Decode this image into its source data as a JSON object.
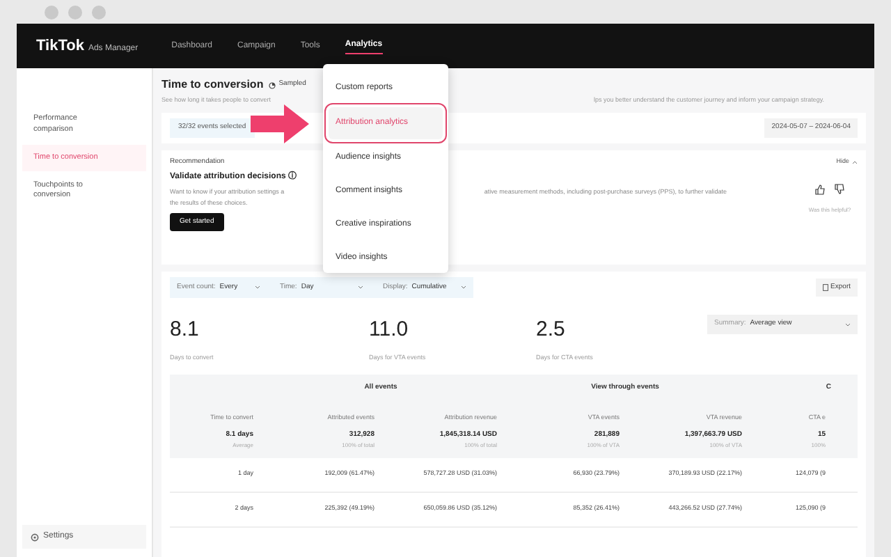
{
  "nav": {
    "logo": "TikTok",
    "logo_suffix": "Ads Manager",
    "items": [
      {
        "label": "Dashboard",
        "selected": false
      },
      {
        "label": "Campaign",
        "selected": false
      },
      {
        "label": "Tools",
        "selected": false
      },
      {
        "label": "Analytics",
        "selected": true
      }
    ]
  },
  "menu": {
    "items": [
      {
        "label": "Custom reports",
        "selected": false
      },
      {
        "label": "Attribution analytics",
        "selected": true
      },
      {
        "label": "Audience insights",
        "selected": false
      },
      {
        "label": "Comment insights",
        "selected": false
      },
      {
        "label": "Creative inspirations",
        "selected": false
      },
      {
        "label": "Video insights",
        "selected": false
      }
    ]
  },
  "sidebar": {
    "items": [
      {
        "label": "Performance comparison",
        "selected": false
      },
      {
        "label": "Time to conversion",
        "selected": true
      },
      {
        "label": "Touchpoints to conversion",
        "selected": false
      }
    ],
    "settings": "Settings"
  },
  "page": {
    "title": "Time to conversion",
    "badge": "Sampled",
    "description": "See how long it takes people to convert",
    "description_end": "lps you better understand the customer journey and inform your campaign strategy.",
    "events": "32/32 events selected",
    "date_range": "2024-05-07 – 2024-06-04"
  },
  "recommendation": {
    "label": "Recommendation",
    "title": "Validate attribution decisions ⓘ",
    "text": "Want to know if your attribution settings a",
    "text_end": "ative measurement methods, including post-purchase surveys (PPS), to further validate",
    "text_line2": "the results of these choices.",
    "button": "Get started",
    "hide": "Hide",
    "feedback": "Was this helpful?"
  },
  "filters": [
    {
      "label": "Event count:",
      "value": "Every"
    },
    {
      "label": "Time:",
      "value": "Day"
    },
    {
      "label": "Display:",
      "value": "Cumulative"
    }
  ],
  "export": "Export",
  "stats": [
    {
      "value": "8.1",
      "label": "Days to convert"
    },
    {
      "value": "11.0",
      "label": "Days for VTA events"
    },
    {
      "value": "2.5",
      "label": "Days for CTA events"
    }
  ],
  "summary_select": {
    "label": "Summary:",
    "value": "Average view"
  },
  "table": {
    "groups": [
      "All events",
      "View through events",
      "C"
    ],
    "columns": [
      "Time to convert",
      "Attributed events",
      "Attribution revenue",
      "VTA events",
      "VTA revenue",
      "CTA e"
    ],
    "summary": [
      [
        "8.1 days",
        "Average"
      ],
      [
        "312,928",
        "100% of total"
      ],
      [
        "1,845,318.14 USD",
        "100% of total"
      ],
      [
        "281,889",
        "100% of VTA"
      ],
      [
        "1,397,663.79 USD",
        "100% of VTA"
      ],
      [
        "15",
        "100%"
      ]
    ],
    "rows": [
      [
        "1 day",
        "192,009 (61.47%)",
        "578,727.28 USD (31.03%)",
        "66,930 (23.79%)",
        "370,189.93 USD (22.17%)",
        "124,079 (9"
      ],
      [
        "2 days",
        "225,392 (49.19%)",
        "650,059.86 USD (35.12%)",
        "85,352 (26.41%)",
        "443,266.52 USD (27.74%)",
        "125,090 (9"
      ]
    ]
  }
}
